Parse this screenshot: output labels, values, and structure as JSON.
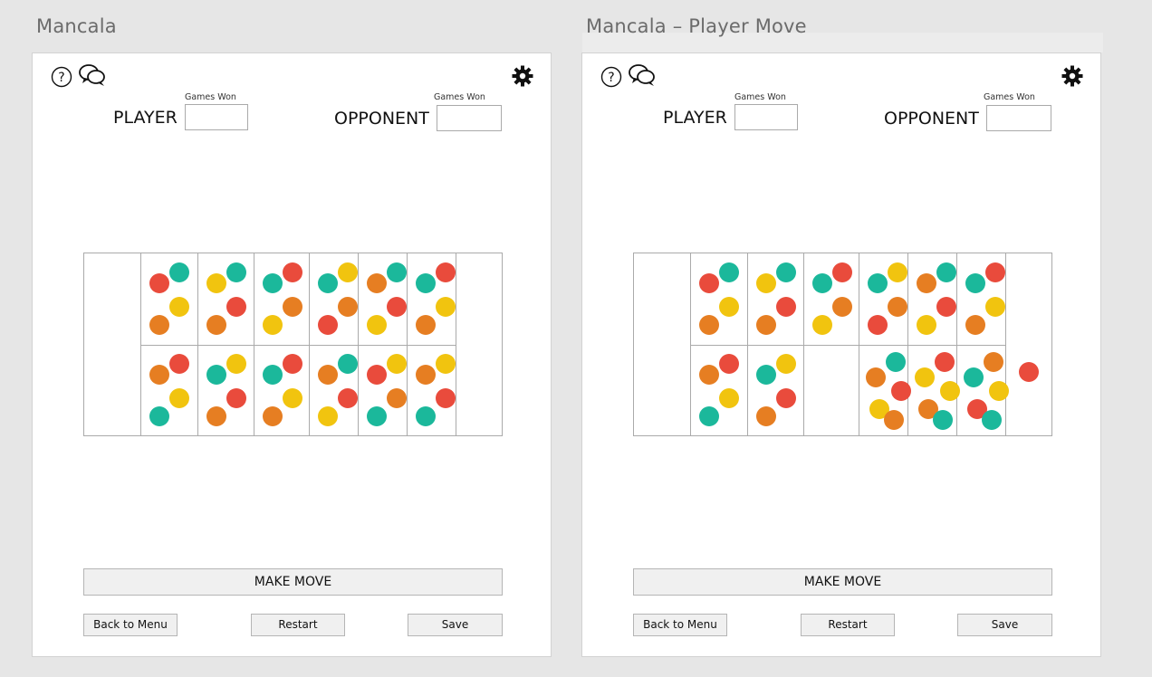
{
  "artboards": [
    {
      "title": "Mancala",
      "player_label": "PLAYER",
      "opponent_label": "OPPONENT",
      "games_won_label": "Games Won",
      "player_score": "",
      "opponent_score": "",
      "buttons": {
        "make_move": "MAKE MOVE",
        "back": "Back to Menu",
        "restart": "Restart",
        "save": "Save"
      },
      "pits": [
        {
          "row": "top",
          "index": 1,
          "seeds": [
            "red",
            "teal",
            "yellow",
            "orange"
          ]
        },
        {
          "row": "top",
          "index": 2,
          "seeds": [
            "yellow",
            "teal",
            "red",
            "orange"
          ]
        },
        {
          "row": "top",
          "index": 3,
          "seeds": [
            "teal",
            "red",
            "orange",
            "yellow"
          ]
        },
        {
          "row": "top",
          "index": 4,
          "seeds": [
            "teal",
            "yellow",
            "orange",
            "red"
          ]
        },
        {
          "row": "top",
          "index": 5,
          "seeds": [
            "orange",
            "teal",
            "red",
            "yellow"
          ]
        },
        {
          "row": "top",
          "index": 6,
          "seeds": [
            "teal",
            "red",
            "yellow",
            "orange"
          ]
        },
        {
          "row": "bottom",
          "index": 1,
          "seeds": [
            "orange",
            "red",
            "yellow",
            "teal"
          ]
        },
        {
          "row": "bottom",
          "index": 2,
          "seeds": [
            "teal",
            "yellow",
            "red",
            "orange"
          ]
        },
        {
          "row": "bottom",
          "index": 3,
          "seeds": [
            "teal",
            "red",
            "yellow",
            "orange"
          ]
        },
        {
          "row": "bottom",
          "index": 4,
          "seeds": [
            "orange",
            "teal",
            "red",
            "yellow"
          ]
        },
        {
          "row": "bottom",
          "index": 5,
          "seeds": [
            "red",
            "yellow",
            "orange",
            "teal"
          ]
        },
        {
          "row": "bottom",
          "index": 6,
          "seeds": [
            "orange",
            "yellow",
            "red",
            "teal"
          ]
        }
      ],
      "store_seeds": []
    },
    {
      "title": "Mancala – Player Move",
      "player_label": "PLAYER",
      "opponent_label": "OPPONENT",
      "games_won_label": "Games Won",
      "player_score": "",
      "opponent_score": "",
      "buttons": {
        "make_move": "MAKE MOVE",
        "back": "Back to Menu",
        "restart": "Restart",
        "save": "Save"
      },
      "pits": [
        {
          "row": "top",
          "index": 1,
          "seeds": [
            "red",
            "teal",
            "yellow",
            "orange"
          ]
        },
        {
          "row": "top",
          "index": 2,
          "seeds": [
            "yellow",
            "teal",
            "red",
            "orange"
          ]
        },
        {
          "row": "top",
          "index": 3,
          "seeds": [
            "teal",
            "red",
            "orange",
            "yellow"
          ]
        },
        {
          "row": "top",
          "index": 4,
          "seeds": [
            "teal",
            "yellow",
            "orange",
            "red"
          ]
        },
        {
          "row": "top",
          "index": 5,
          "seeds": [
            "orange",
            "teal",
            "red",
            "yellow"
          ]
        },
        {
          "row": "top",
          "index": 6,
          "seeds": [
            "teal",
            "red",
            "yellow",
            "orange"
          ]
        },
        {
          "row": "bottom",
          "index": 1,
          "seeds": [
            "orange",
            "red",
            "yellow",
            "teal"
          ]
        },
        {
          "row": "bottom",
          "index": 2,
          "seeds": [
            "teal",
            "yellow",
            "red",
            "orange"
          ]
        },
        {
          "row": "bottom",
          "index": 3,
          "seeds": []
        },
        {
          "row": "bottom",
          "index": 4,
          "seeds": [
            "orange",
            "teal",
            "red",
            "yellow",
            "orange"
          ]
        },
        {
          "row": "bottom",
          "index": 5,
          "seeds": [
            "yellow",
            "red",
            "yellow",
            "orange",
            "teal"
          ]
        },
        {
          "row": "bottom",
          "index": 6,
          "seeds": [
            "teal",
            "orange",
            "yellow",
            "red",
            "teal"
          ]
        }
      ],
      "store_seeds": [
        "red"
      ]
    }
  ],
  "colors": {
    "red": "#e94b3c",
    "teal": "#1bb89b",
    "yellow": "#f1c40f",
    "orange": "#e67e22"
  },
  "icons": [
    "help-icon",
    "chat-icon",
    "gear-icon"
  ]
}
